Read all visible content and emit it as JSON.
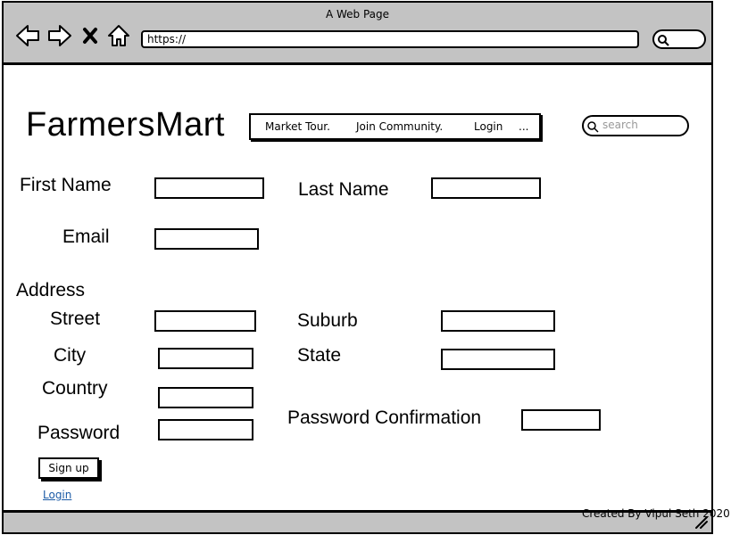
{
  "window": {
    "title": "A Web Page",
    "url": "https://"
  },
  "icons": {
    "back": "arrow-left-icon",
    "forward": "arrow-right-icon",
    "close": "close-icon",
    "home": "home-icon",
    "search": "search-icon",
    "resize": "resize-handle-icon"
  },
  "site": {
    "logo": "FarmersMart",
    "nav": [
      "Market Tour.",
      "Join Community.",
      "Login",
      "..."
    ],
    "search_placeholder": "search"
  },
  "form": {
    "first_name_label": "First Name",
    "last_name_label": "Last Name",
    "email_label": "Email",
    "address_label": "Address",
    "street_label": "Street",
    "suburb_label": "Suburb",
    "city_label": "City",
    "state_label": "State",
    "country_label": "Country",
    "password_label": "Password",
    "password_confirm_label": "Password Confirmation",
    "signup_label": "Sign up",
    "login_link": "Login"
  },
  "footer": {
    "credit": "Created By Vipul Seth 2020"
  }
}
